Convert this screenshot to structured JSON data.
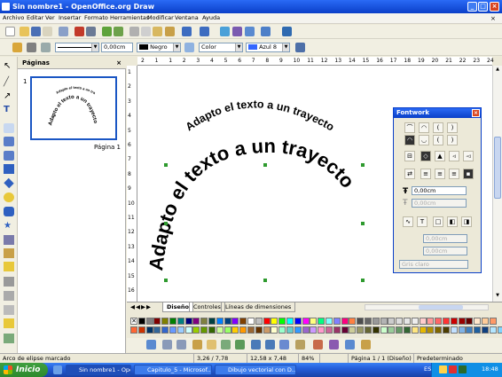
{
  "window": {
    "title": "Sin nombre1 - OpenOffice.org Draw"
  },
  "menu": [
    "Archivo",
    "Editar",
    "Ver",
    "Insertar",
    "Formato",
    "Herramientas",
    "Modificar",
    "Ventana",
    "Ayuda"
  ],
  "line_toolbar": {
    "line_width": "0,00cm",
    "line_color": "Negro",
    "fill_type": "Color",
    "fill_color": "Azul 8"
  },
  "slides_panel": {
    "title": "Páginas",
    "slide_number": "1",
    "page_label": "Página 1"
  },
  "ruler": {
    "h_ticks": [
      "2",
      "1",
      "1",
      "2",
      "3",
      "4",
      "5",
      "6",
      "7",
      "8",
      "9",
      "10",
      "11",
      "12",
      "13",
      "14",
      "15",
      "16",
      "17",
      "18",
      "19",
      "20",
      "21",
      "22",
      "23",
      "24"
    ],
    "v_ticks": [
      "1",
      "2",
      "3",
      "4",
      "5",
      "6",
      "7",
      "8",
      "9",
      "10",
      "11",
      "12",
      "13",
      "14",
      "15",
      "16"
    ]
  },
  "canvas": {
    "small_text": "Adapto el texto a un trayecto",
    "big_text": "Adapto el texto a un trayecto"
  },
  "tabs": [
    "Diseño",
    "Controles",
    "Líneas de dimensiones"
  ],
  "fontwork": {
    "title": "Fontwork",
    "distance": "0,00cm",
    "indent": "0,00cm",
    "shadow_x": "0,00cm",
    "shadow_y": "0,00cm",
    "shadow_color": "Gris claro"
  },
  "status": {
    "selection": "Arco de elipse marcado",
    "position": "3,26 / 7,78",
    "size": "12,58 x 7,48",
    "zoom": "84%",
    "page": "Página 1 / 1 (Diseño)",
    "layout": "Predeterminado"
  },
  "taskbar": {
    "start": "Inicio",
    "tasks": [
      "Sin nombre1 - OpenO...",
      "Capitulo_5 - Microsof...",
      "Dibujo vectorial con D..."
    ],
    "lang": "ES",
    "time": "18:48"
  },
  "palette_colors": [
    "#000000",
    "#808080",
    "#800000",
    "#808000",
    "#008000",
    "#008080",
    "#000080",
    "#800080",
    "#808040",
    "#004040",
    "#0080ff",
    "#004080",
    "#8000ff",
    "#804000",
    "#ffffff",
    "#c0c0c0",
    "#ff0000",
    "#ffff00",
    "#00ff00",
    "#00ffff",
    "#0000ff",
    "#ff00ff",
    "#ffff80",
    "#00ff80",
    "#80ffff",
    "#8080ff",
    "#ff0080",
    "#ff8040",
    "#4d4d4d",
    "#666666",
    "#999999",
    "#b3b3b3",
    "#cccccc",
    "#dddddd",
    "#e6e6e6",
    "#eeeeee",
    "#ffcccc",
    "#ff9999",
    "#ff6666",
    "#ff3333",
    "#cc0000",
    "#990000",
    "#660000",
    "#ffe6cc",
    "#ffcc99",
    "#ff9966",
    "#ff6633",
    "#cc3300",
    "#003366",
    "#336699",
    "#3366cc",
    "#6699ff",
    "#99ccff",
    "#ccffff",
    "#99cc00",
    "#669900",
    "#336600",
    "#ccff99",
    "#99ff66",
    "#ffcc00",
    "#ff9900",
    "#996633",
    "#663300",
    "#cc9966",
    "#ffffcc",
    "#99ffcc",
    "#66cccc",
    "#3399ff",
    "#9966cc",
    "#cc99ff",
    "#ff99cc",
    "#cc6699",
    "#993366",
    "#660033",
    "#cccc99",
    "#999966",
    "#666633",
    "#333300",
    "#ccffcc",
    "#99cc99",
    "#669966",
    "#336633",
    "#ffe680",
    "#e6b800",
    "#b38f00",
    "#806600",
    "#4d3d00",
    "#c2e0ff",
    "#7fb2e6",
    "#3f7fbf",
    "#1f5f9f",
    "#0f3f7f",
    "#b3e6ff",
    "#80d4ff"
  ]
}
